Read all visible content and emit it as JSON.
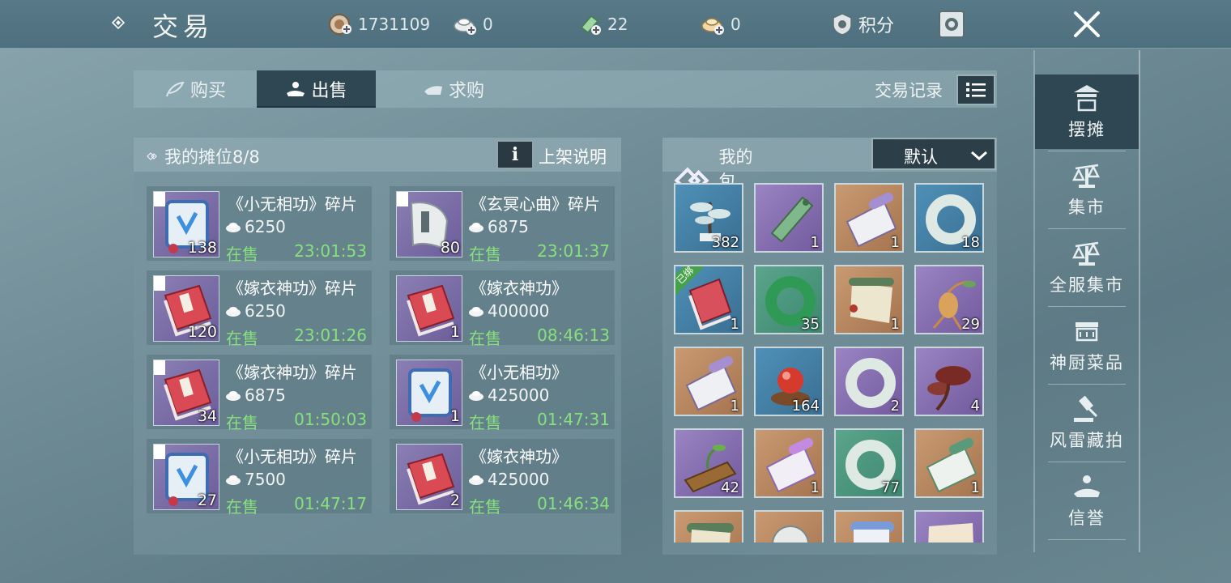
{
  "header": {
    "title": "交易",
    "currencies": [
      {
        "icon": "coin-plus-icon",
        "value": "1731109"
      },
      {
        "icon": "silver-ingot-plus-icon",
        "value": "0"
      },
      {
        "icon": "ticket-plus-icon",
        "value": "22"
      },
      {
        "icon": "gold-ingot-plus-icon",
        "value": "0"
      }
    ],
    "points_label": "积分"
  },
  "tabs": [
    {
      "label": "购买",
      "active": false
    },
    {
      "label": "出售",
      "active": true
    },
    {
      "label": "求购",
      "active": false
    }
  ],
  "trade_log_label": "交易记录",
  "stall": {
    "title": "我的摊位8/8",
    "info_label": "上架说明",
    "items": [
      {
        "name": "《小无相功》碎片",
        "price": "6250",
        "status": "在售",
        "timer": "23:01:53",
        "qty": "138",
        "icon": "blue-scroll-icon"
      },
      {
        "name": "《玄冥心曲》碎片",
        "price": "6875",
        "status": "在售",
        "timer": "23:01:37",
        "qty": "80",
        "icon": "white-scroll-icon"
      },
      {
        "name": "《嫁衣神功》碎片",
        "price": "6250",
        "status": "在售",
        "timer": "23:01:26",
        "qty": "120",
        "icon": "red-book-icon"
      },
      {
        "name": "《嫁衣神功》",
        "price": "400000",
        "status": "在售",
        "timer": "08:46:13",
        "qty": "1",
        "icon": "red-book-icon"
      },
      {
        "name": "《嫁衣神功》碎片",
        "price": "6875",
        "status": "在售",
        "timer": "01:50:03",
        "qty": "34",
        "icon": "red-book-icon"
      },
      {
        "name": "《小无相功》",
        "price": "425000",
        "status": "在售",
        "timer": "01:47:31",
        "qty": "1",
        "icon": "blue-scroll-icon"
      },
      {
        "name": "《小无相功》碎片",
        "price": "7500",
        "status": "在售",
        "timer": "01:47:17",
        "qty": "27",
        "icon": "blue-scroll-icon"
      },
      {
        "name": "《嫁衣神功》",
        "price": "425000",
        "status": "在售",
        "timer": "01:46:34",
        "qty": "2",
        "icon": "red-book-icon"
      }
    ]
  },
  "bag": {
    "title": "我的包裹:",
    "sort_value": "默认",
    "slots": [
      {
        "qty": "382",
        "bg": "blue",
        "icon": "bonsai-pine-icon"
      },
      {
        "qty": "1",
        "bg": "purple",
        "icon": "jade-pendant-icon"
      },
      {
        "qty": "1",
        "bg": "orange",
        "icon": "scroll-book-icon"
      },
      {
        "qty": "18",
        "bg": "blue",
        "icon": "jade-ring-icon"
      },
      {
        "qty": "1",
        "bg": "blue",
        "icon": "bound-book-icon",
        "bound_label": "已绑"
      },
      {
        "qty": "35",
        "bg": "green",
        "icon": "green-jade-ring-icon"
      },
      {
        "qty": "1",
        "bg": "orange",
        "icon": "green-scroll-icon"
      },
      {
        "qty": "29",
        "bg": "purple",
        "icon": "ginseng-root-icon"
      },
      {
        "qty": "1",
        "bg": "orange",
        "icon": "scroll-book-icon"
      },
      {
        "qty": "164",
        "bg": "blue",
        "icon": "red-pearl-icon"
      },
      {
        "qty": "2",
        "bg": "purple",
        "icon": "jade-ring-icon"
      },
      {
        "qty": "4",
        "bg": "purple",
        "icon": "lingzhi-mushroom-icon"
      },
      {
        "qty": "42",
        "bg": "purple",
        "icon": "sprout-wood-icon"
      },
      {
        "qty": "1",
        "bg": "orange",
        "icon": "purple-scroll-icon"
      },
      {
        "qty": "77",
        "bg": "green",
        "icon": "jade-ring-icon"
      },
      {
        "qty": "1",
        "bg": "orange",
        "icon": "green-scroll-icon"
      },
      {
        "qty": "",
        "bg": "orange",
        "icon": "green-scroll-icon"
      },
      {
        "qty": "",
        "bg": "orange",
        "icon": "compass-scroll-icon"
      },
      {
        "qty": "",
        "bg": "orange",
        "icon": "blue-scroll-icon"
      },
      {
        "qty": "",
        "bg": "purple",
        "icon": "parchment-icon"
      }
    ]
  },
  "sidebar": [
    {
      "label": "摆摊",
      "icon": "pavilion-stall-icon",
      "active": true
    },
    {
      "label": "集市",
      "icon": "scale-market-icon",
      "active": false
    },
    {
      "label": "全服集市",
      "icon": "scale-server-market-icon",
      "active": false
    },
    {
      "label": "神厨菜品",
      "icon": "kitchen-icon",
      "active": false
    },
    {
      "label": "风雷藏拍",
      "icon": "auction-hammer-icon",
      "active": false
    },
    {
      "label": "信誉",
      "icon": "reputation-hand-icon",
      "active": false
    }
  ],
  "colors": {
    "active_bg": "#2f4653",
    "timer_green": "#87e07e",
    "panel_bg": "#7896a0"
  }
}
